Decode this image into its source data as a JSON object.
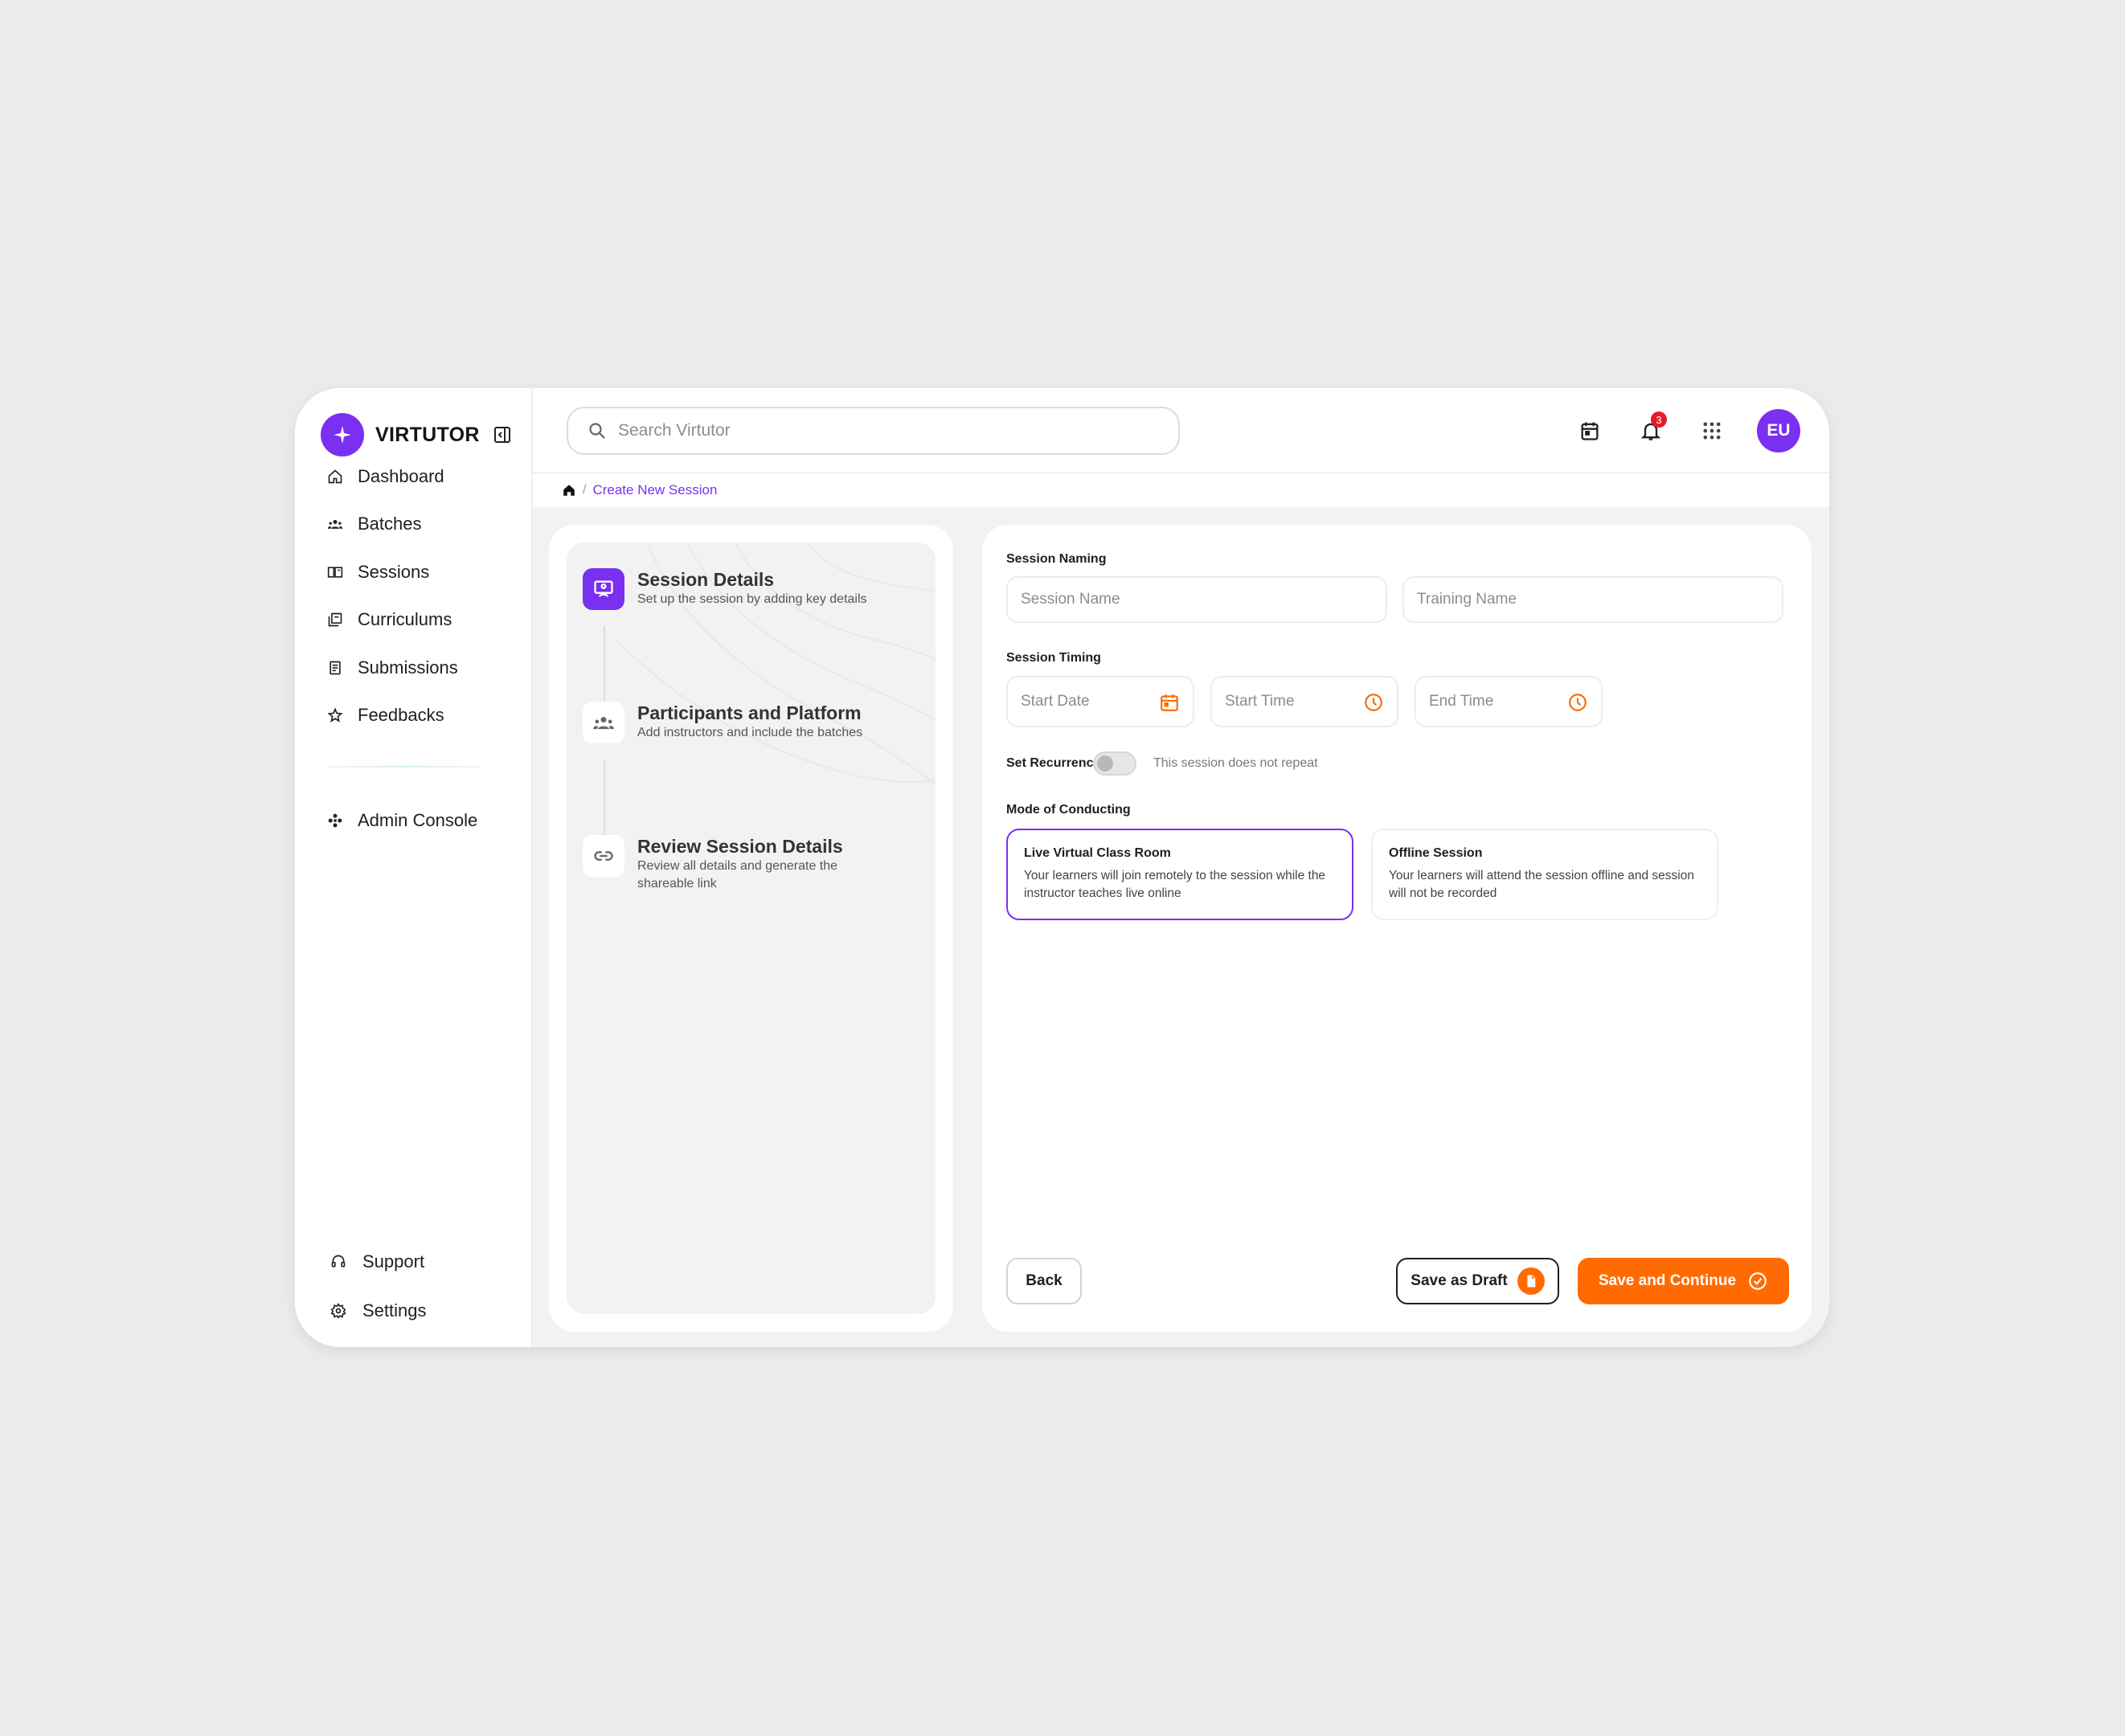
{
  "app": {
    "name": "VIRTUTOR"
  },
  "sidebar": {
    "items": [
      {
        "label": "Dashboard"
      },
      {
        "label": "Batches"
      },
      {
        "label": "Sessions"
      },
      {
        "label": "Curriculums"
      },
      {
        "label": "Submissions"
      },
      {
        "label": "Feedbacks"
      }
    ],
    "admin": {
      "label": "Admin Console"
    },
    "bottom": [
      {
        "label": "Support"
      },
      {
        "label": "Settings"
      }
    ]
  },
  "header": {
    "search_placeholder": "Search Virtutor",
    "notification_count": "3",
    "avatar_initials": "EU"
  },
  "breadcrumb": {
    "current": "Create New Session",
    "separator": "/"
  },
  "stepper": {
    "steps": [
      {
        "title": "Session Details",
        "desc": "Set up the session by adding key details",
        "icon": "monitor-user-icon",
        "active": true
      },
      {
        "title": "Participants and Platform",
        "desc": "Add instructors and include the batches",
        "icon": "group-icon",
        "active": false
      },
      {
        "title": "Review Session Details",
        "desc": "Review all details and generate the shareable link",
        "icon": "link-icon",
        "active": false
      }
    ]
  },
  "form": {
    "naming_label": "Session Naming",
    "session_name_placeholder": "Session Name",
    "training_name_placeholder": "Training Name",
    "timing_label": "Session Timing",
    "start_date_placeholder": "Start Date",
    "start_time_placeholder": "Start Time",
    "end_time_placeholder": "End Time",
    "recurrence_label": "Set Recurrence",
    "recurrence_text": "This session does not repeat",
    "recurrence_enabled": false,
    "mode_label": "Mode of Conducting",
    "modes": [
      {
        "title": "Live Virtual Class Room",
        "desc": "Your learners will join remotely to the session while the instructor teaches live online",
        "selected": true
      },
      {
        "title": "Offline Session",
        "desc": "Your learners will attend the session offline and session will not be recorded",
        "selected": false
      }
    ]
  },
  "actions": {
    "back": "Back",
    "save_draft": "Save as Draft",
    "save_continue": "Save and Continue"
  },
  "colors": {
    "brand": "#7b2ff0",
    "accent": "#ff6b00",
    "badge": "#e5192a"
  }
}
